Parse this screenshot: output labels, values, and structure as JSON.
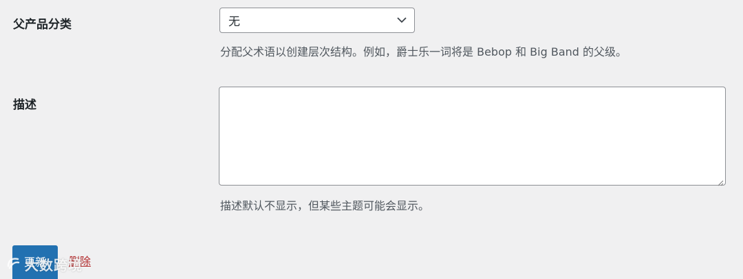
{
  "fields": {
    "parent": {
      "label": "父产品分类",
      "selected": "无",
      "help": "分配父术语以创建层次结构。例如，爵士乐一词将是 Bebop 和 Big Band 的父级。"
    },
    "description": {
      "label": "描述",
      "value": "",
      "help": "描述默认不显示，但某些主题可能会显示。"
    }
  },
  "actions": {
    "update_label": "更新",
    "delete_label": "删除"
  },
  "watermark": {
    "text": "大数跨境"
  },
  "colors": {
    "background": "#f0f0f1",
    "primary": "#2271b1",
    "delete": "#b32d2e",
    "help_text": "#50575e"
  },
  "icons": {
    "select": "chevron-down-icon",
    "textarea": "resize-handle-icon",
    "watermark": "watermark-logo-icon"
  }
}
